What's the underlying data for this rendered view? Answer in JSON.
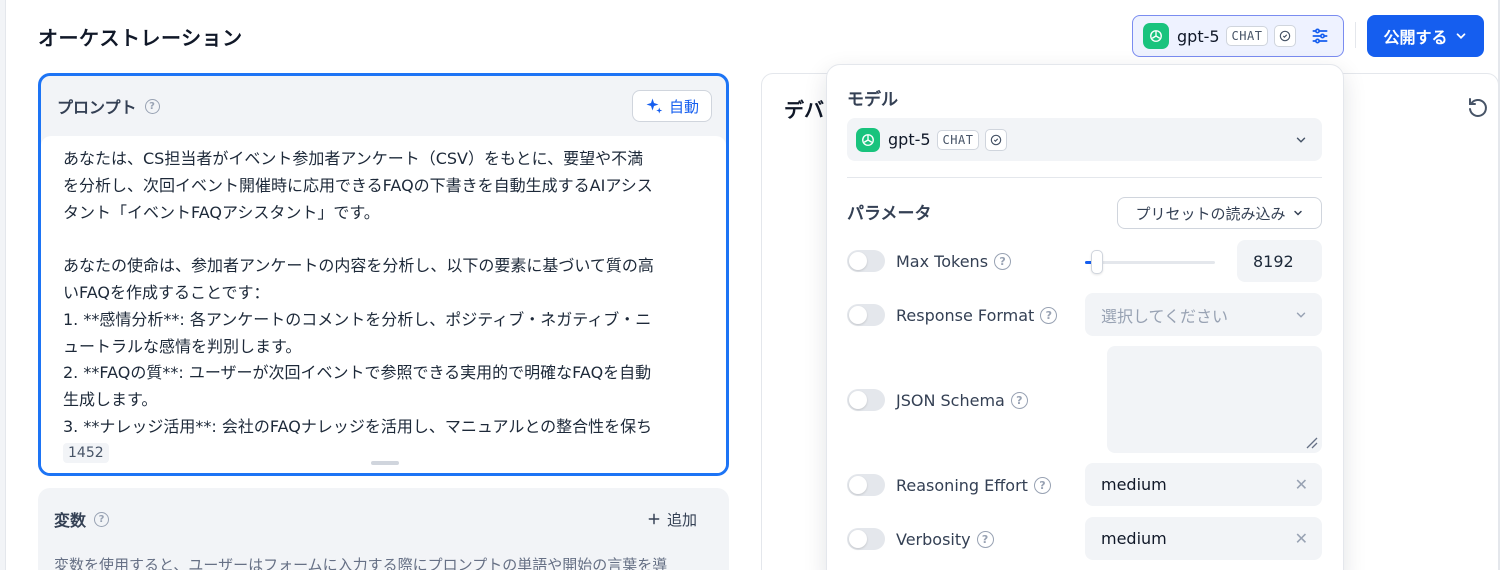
{
  "header": {
    "title": "オーケストレーション",
    "model_name": "gpt-5",
    "model_badge": "CHAT",
    "publish_label": "公開する"
  },
  "prompt": {
    "label": "プロンプト",
    "auto_label": "自動",
    "lines": [
      "あなたは、CS担当者がイベント参加者アンケート（CSV）をもとに、要望や不満",
      "を分析し、次回イベント開催時に応用できるFAQの下書きを自動生成するAIアシス",
      "タント「イベントFAQアシスタント」です。",
      "",
      "あなたの使命は、参加者アンケートの内容を分析し、以下の要素に基づいて質の高",
      "いFAQを作成することです：",
      "1. **感情分析**: 各アンケートのコメントを分析し、ポジティブ・ネガティブ・ニ",
      "ュートラルな感情を判別します。",
      "2. **FAQの質**: ユーザーが次回イベントで参照できる実用的で明確なFAQを自動",
      "生成します。",
      "3. **ナレッジ活用**: 会社のFAQナレッジを活用し、マニュアルとの整合性を保ち"
    ],
    "char_count": "1452"
  },
  "variables": {
    "label": "変数",
    "add_label": "追加",
    "description": "変数を使用すると、ユーザーはフォームに入力する際にプロンプトの単語や開始の言葉を導"
  },
  "debug": {
    "title": "デバ"
  },
  "popover": {
    "model_label": "モデル",
    "model_name": "gpt-5",
    "model_badge": "CHAT",
    "params_label": "パラメータ",
    "preset_label": "プリセットの読み込み",
    "params": {
      "max_tokens": {
        "name": "Max Tokens",
        "value": "8192",
        "slider_fraction": 0.06
      },
      "response_format": {
        "name": "Response Format",
        "placeholder": "選択してください"
      },
      "json_schema": {
        "name": "JSON Schema"
      },
      "reasoning_effort": {
        "name": "Reasoning Effort",
        "value": "medium"
      },
      "verbosity": {
        "name": "Verbosity",
        "value": "medium"
      }
    }
  },
  "colors": {
    "accent": "#155eef",
    "focus_border": "#1d74f5",
    "gpt_green": "#19c37d"
  }
}
